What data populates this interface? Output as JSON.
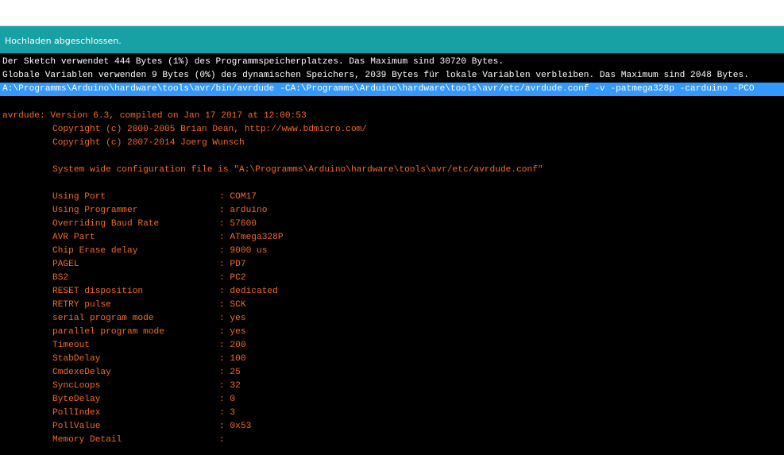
{
  "status": {
    "message": "Hochladen abgeschlossen."
  },
  "console": {
    "summary_lines": [
      "Der Sketch verwendet 444 Bytes (1%) des Programmspeicherplatzes. Das Maximum sind 30720 Bytes.",
      "Globale Variablen verwenden 9 Bytes (0%) des dynamischen Speichers, 2039 Bytes für lokale Variablen verbleiben. Das Maximum sind 2048 Bytes."
    ],
    "command_line": "A:\\Programms\\Arduino\\hardware\\tools\\avr/bin/avrdude -CA:\\Programms\\Arduino\\hardware\\tools\\avr/etc/avrdude.conf -v -patmega328p -carduino -PCO",
    "version_line": "avrdude: Version 6.3, compiled on Jan 17 2017 at 12:00:53",
    "copyright_lines": [
      "Copyright (c) 2000-2005 Brian Dean, http://www.bdmicro.com/",
      "Copyright (c) 2007-2014 Joerg Wunsch"
    ],
    "config_line": "System wide configuration file is \"A:\\Programms\\Arduino\\hardware\\tools\\avr/etc/avrdude.conf\"",
    "settings": [
      {
        "key": "Using Port",
        "value": ": COM17"
      },
      {
        "key": "Using Programmer",
        "value": ": arduino"
      },
      {
        "key": "Overriding Baud Rate",
        "value": ": 57600"
      },
      {
        "key": "AVR Part",
        "value": ": ATmega328P"
      },
      {
        "key": "Chip Erase delay",
        "value": ": 9000 us"
      },
      {
        "key": "PAGEL",
        "value": ": PD7"
      },
      {
        "key": "BS2",
        "value": ": PC2"
      },
      {
        "key": "RESET disposition",
        "value": ": dedicated"
      },
      {
        "key": "RETRY pulse",
        "value": ": SCK"
      },
      {
        "key": "serial program mode",
        "value": ": yes"
      },
      {
        "key": "parallel program mode",
        "value": ": yes"
      },
      {
        "key": "Timeout",
        "value": ": 200"
      },
      {
        "key": "StabDelay",
        "value": ": 100"
      },
      {
        "key": "CmdexeDelay",
        "value": ": 25"
      },
      {
        "key": "SyncLoops",
        "value": ": 32"
      },
      {
        "key": "ByteDelay",
        "value": ": 0"
      },
      {
        "key": "PollIndex",
        "value": ": 3"
      },
      {
        "key": "PollValue",
        "value": ": 0x53"
      },
      {
        "key": "Memory Detail",
        "value": ":"
      }
    ]
  },
  "colors": {
    "status_bar": "#17a1a5",
    "console_bg": "#000000",
    "output_text": "#ffffff",
    "error_text": "#f26a2a",
    "selection": "#3399ff"
  }
}
